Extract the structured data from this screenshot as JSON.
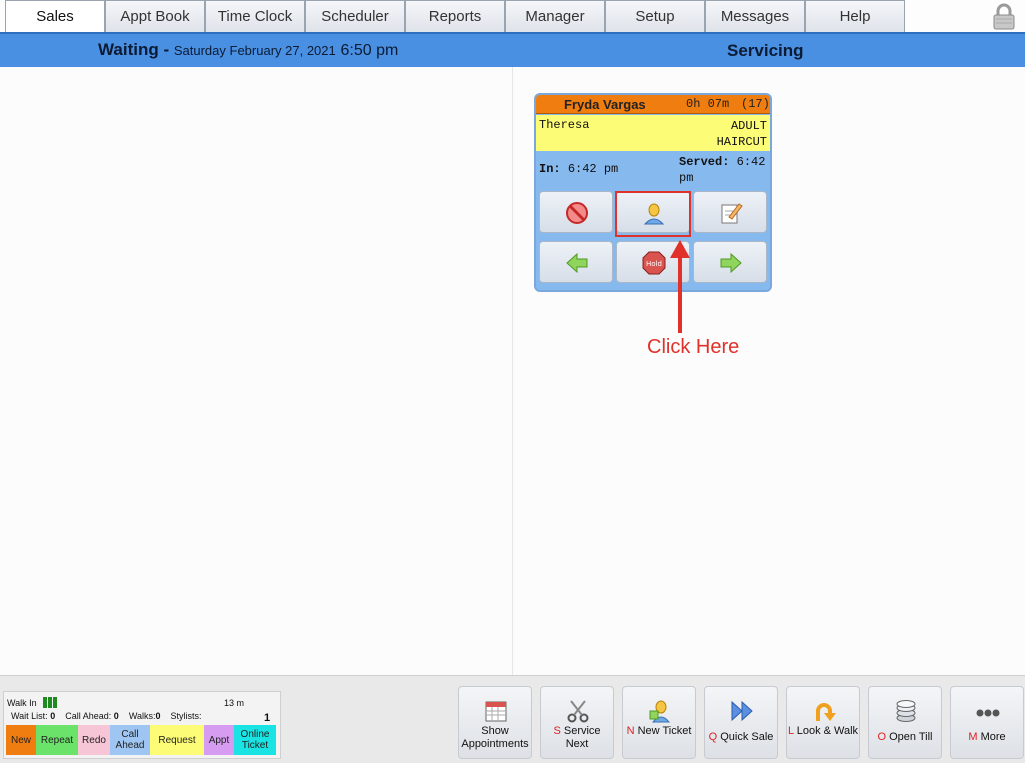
{
  "tabs": [
    "Sales",
    "Appt Book",
    "Time Clock",
    "Scheduler",
    "Reports",
    "Manager",
    "Setup",
    "Messages",
    "Help"
  ],
  "header": {
    "waiting_label": "Waiting - ",
    "date": "Saturday February 27, 2021",
    "time": "6:50 pm",
    "servicing_label": "Servicing"
  },
  "ticket": {
    "client": "Fryda Vargas",
    "duration": "0h 07m",
    "number": "(17)",
    "stylist": "Theresa",
    "service_line1": "ADULT",
    "service_line2": "HAIRCUT",
    "in_label": "In:",
    "in_time": "6:42 pm",
    "served_label": "Served:",
    "served_time": "6:42",
    "served_time2": "pm",
    "header_color": "#f07d10",
    "service_color": "#fcfc77"
  },
  "annotation": {
    "text": "Click Here",
    "color": "#e0312b"
  },
  "legend": {
    "walk_in": "Walk In",
    "minutes": "13 m",
    "wait_list_label": "Wait List:",
    "wait_list": "0",
    "call_ahead_label": "Call Ahead:",
    "call_ahead": "0",
    "walks_label": "Walks:",
    "walks": "0",
    "stylists_label": "Stylists:",
    "count": "1",
    "chips": [
      {
        "label": "New",
        "color": "#f07d10"
      },
      {
        "label": "Repeat",
        "color": "#6be36b"
      },
      {
        "label": "Redo",
        "color": "#f7c6d6"
      },
      {
        "label": "Call Ahead",
        "color": "#9fc6f2"
      },
      {
        "label": "Request",
        "color": "#fcfc77"
      },
      {
        "label": "Appt",
        "color": "#d59cf2"
      },
      {
        "label": "Online Ticket",
        "color": "#19e3e3"
      }
    ]
  },
  "buttons": {
    "show_appointments": "Show Appointments",
    "service_next_key": "S",
    "service_next": "Service Next",
    "new_ticket_key": "N",
    "new_ticket": "New Ticket",
    "quick_sale_key": "Q",
    "quick_sale": "Quick Sale",
    "look_walk_key": "L",
    "look_walk": "Look & Walk",
    "open_till_key": "O",
    "open_till": "Open Till",
    "more_key": "M",
    "more": "More"
  }
}
